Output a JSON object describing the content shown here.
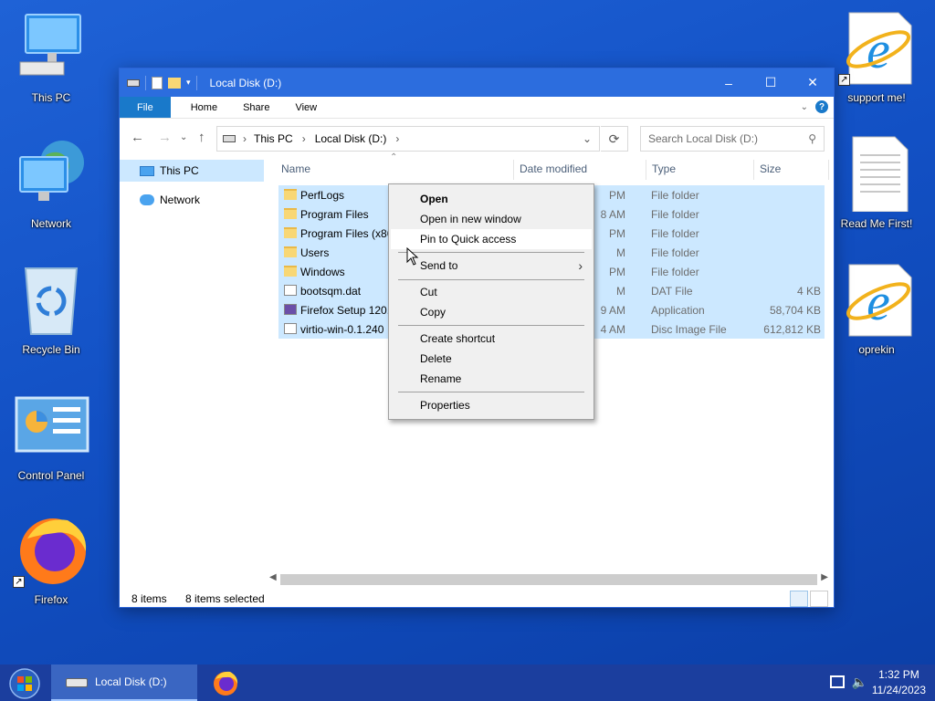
{
  "desktop": {
    "icons_left": [
      {
        "label": "This PC",
        "icon": "computer-icon"
      },
      {
        "label": "Network",
        "icon": "network-icon"
      },
      {
        "label": "Recycle Bin",
        "icon": "recycle-bin-icon"
      },
      {
        "label": "Control Panel",
        "icon": "control-panel-icon"
      },
      {
        "label": "Firefox",
        "icon": "firefox-icon"
      }
    ],
    "icons_right": [
      {
        "label": "support me!",
        "icon": "internet-explorer-icon"
      },
      {
        "label": "Read Me First!",
        "icon": "text-document-icon"
      },
      {
        "label": "oprekin",
        "icon": "internet-explorer-icon"
      }
    ]
  },
  "explorer": {
    "title": "Local Disk (D:)",
    "ribbon_tabs": [
      "File",
      "Home",
      "Share",
      "View"
    ],
    "breadcrumb": [
      "This PC",
      "Local Disk (D:)"
    ],
    "search_placeholder": "Search Local Disk (D:)",
    "nav_pane": [
      "This PC",
      "Network"
    ],
    "columns": [
      "Name",
      "Date modified",
      "Type",
      "Size"
    ],
    "files": [
      {
        "name": "PerfLogs",
        "date": "PM",
        "type": "File folder",
        "size": "",
        "kind": "folder"
      },
      {
        "name": "Program Files",
        "date": "8 AM",
        "type": "File folder",
        "size": "",
        "kind": "folder"
      },
      {
        "name": "Program Files (x86)",
        "date": "PM",
        "type": "File folder",
        "size": "",
        "kind": "folder"
      },
      {
        "name": "Users",
        "date": "M",
        "type": "File folder",
        "size": "",
        "kind": "folder"
      },
      {
        "name": "Windows",
        "date": "PM",
        "type": "File folder",
        "size": "",
        "kind": "folder"
      },
      {
        "name": "bootsqm.dat",
        "date": "M",
        "type": "DAT File",
        "size": "4 KB",
        "kind": "file"
      },
      {
        "name": "Firefox Setup 120.0",
        "date": "9 AM",
        "type": "Application",
        "size": "58,704 KB",
        "kind": "app"
      },
      {
        "name": "virtio-win-0.1.240",
        "date": "4 AM",
        "type": "Disc Image File",
        "size": "612,812 KB",
        "kind": "disc"
      }
    ],
    "status_items": "8 items",
    "status_selected": "8 items selected"
  },
  "context_menu": {
    "items": [
      "Open",
      "Open in new window",
      "Pin to Quick access",
      "Send to",
      "Cut",
      "Copy",
      "Create shortcut",
      "Delete",
      "Rename",
      "Properties"
    ],
    "highlighted": "Pin to Quick access"
  },
  "taskbar": {
    "active_window": "Local Disk (D:)",
    "time": "1:32 PM",
    "date": "11/24/2023"
  },
  "colors": {
    "desktop": "#1250c4",
    "titlebar": "#2c6dde",
    "selection": "#cce8ff",
    "file_tab": "#1979ca",
    "taskbar": "#1b3e9e"
  }
}
